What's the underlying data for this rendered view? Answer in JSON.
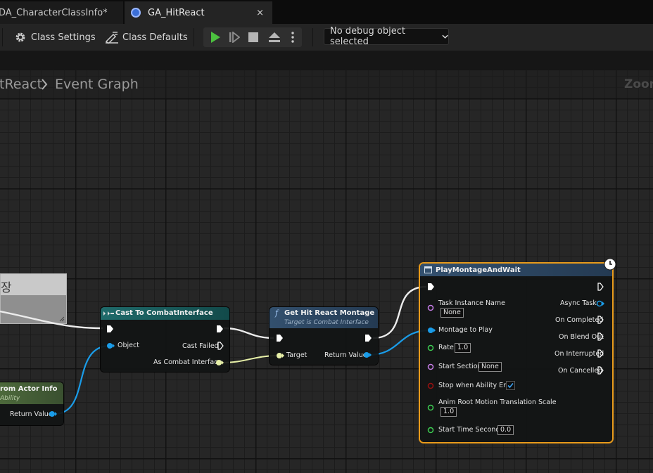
{
  "tabs": [
    {
      "label": "DA_CharacterClassInfo*"
    },
    {
      "label": "GA_HitReact",
      "close": "×"
    }
  ],
  "toolbar": {
    "class_settings": "Class Settings",
    "class_defaults": "Class Defaults",
    "debug_selector": "No debug object selected"
  },
  "breadcrumb": {
    "parent": "tReact",
    "separator": ">",
    "current": "Event Graph"
  },
  "zoom_label": "Zoom",
  "comment": {
    "text": "장"
  },
  "nodes": {
    "actor_info": {
      "title": "rom Actor Info",
      "subtitle": "Ability",
      "return_label": "Return Value"
    },
    "cast": {
      "title": "Cast To CombatInterface",
      "object": "Object",
      "cast_failed": "Cast Failed",
      "as_combat": "As Combat Interface"
    },
    "get_montage": {
      "title": "Get Hit React Montage",
      "subtitle": "Target is Combat Interface",
      "target": "Target",
      "return_label": "Return Value"
    },
    "play_montage": {
      "title": "PlayMontageAndWait",
      "task_instance_name": "Task Instance Name",
      "task_instance_value": "None",
      "montage_to_play": "Montage to Play",
      "rate": "Rate",
      "rate_value": "1.0",
      "start_section": "Start Section",
      "start_section_value": "None",
      "stop_when_ends": "Stop when Ability Ends",
      "stop_when_ends_checked": true,
      "anim_root_motion": "Anim Root Motion Translation Scale",
      "anim_root_motion_value": "1.0",
      "start_time": "Start Time Seconds",
      "start_time_value": "0.0",
      "outputs": {
        "async_task": "Async Task",
        "on_completed": "On Completed",
        "on_blend_out": "On Blend Out",
        "on_interrupted": "On Interrupted",
        "on_cancelled": "On Cancelled"
      }
    }
  },
  "colors": {
    "exec": "#ffffff",
    "object_pin": "#1a9ce8",
    "interface_pin": "#e7f0a8",
    "name_pin": "#c77de8",
    "float_pin": "#3dcc52",
    "bool_pin": "#9a1010",
    "selected_outline": "#e89a1a",
    "cast_header": "#1f6b6b",
    "function_header": "#33506e",
    "pure_header": "#4e6b3c"
  },
  "icons": {
    "tab_blueprint": "blueprint-icon",
    "class_settings": "gear-icon",
    "class_defaults": "defaults-icon",
    "play": "play-icon",
    "step": "step-icon",
    "stop": "stop-icon",
    "eject": "eject-icon",
    "more": "more-options-icon",
    "dropdown": "chevron-down-icon",
    "latent": "clock-icon",
    "checkbox": "checkmark-icon"
  }
}
